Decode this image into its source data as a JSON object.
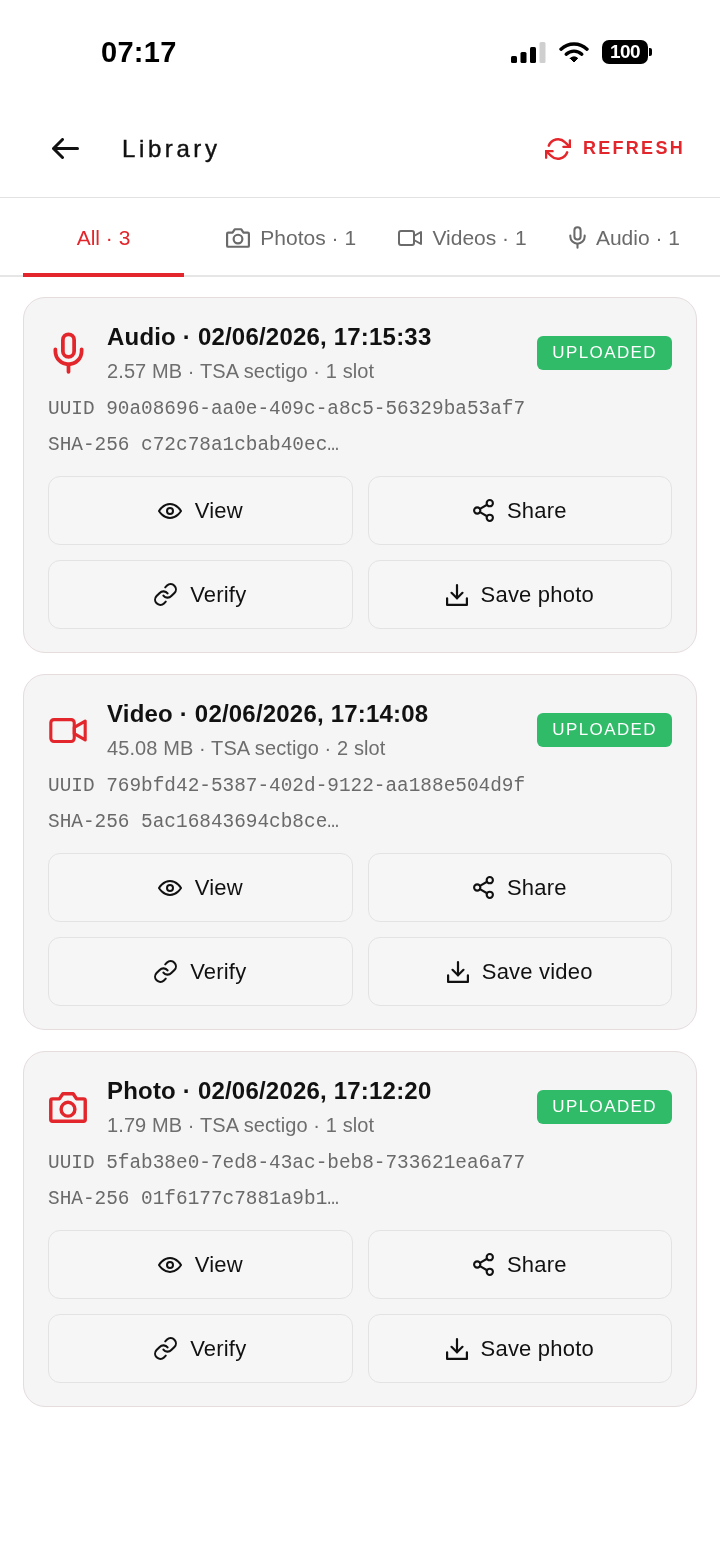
{
  "status_bar": {
    "time": "07:17",
    "battery": "100"
  },
  "header": {
    "title": "Library",
    "action": "REFRESH"
  },
  "tabs": [
    {
      "kind": "all",
      "label": "All · 3",
      "selected": true
    },
    {
      "kind": "photo",
      "label": "Photos · 1",
      "selected": false
    },
    {
      "kind": "video",
      "label": "Videos · 1",
      "selected": false
    },
    {
      "kind": "audio",
      "label": "Audio · 1",
      "selected": false
    }
  ],
  "items": [
    {
      "kind": "audio",
      "title": "Audio · 02/06/2026, 17:15:33",
      "details": "2.57 MB · TSA sectigo · 1 slot",
      "status": {
        "kind": "uploaded",
        "label": "UPLOADED"
      },
      "uuid": "UUID 90a08696-aa0e-409c-a8c5-56329ba53af7",
      "hash": "SHA-256 c72c78a1cbab40ec…",
      "actions": [
        {
          "kind": "view",
          "label": "View"
        },
        {
          "kind": "share",
          "label": "Share"
        },
        {
          "kind": "verify",
          "label": "Verify"
        },
        {
          "kind": "save",
          "label": "Save photo"
        }
      ]
    },
    {
      "kind": "video",
      "title": "Video · 02/06/2026, 17:14:08",
      "details": "45.08 MB · TSA sectigo · 2 slot",
      "status": {
        "kind": "uploaded",
        "label": "UPLOADED"
      },
      "uuid": "UUID 769bfd42-5387-402d-9122-aa188e504d9f",
      "hash": "SHA-256 5ac16843694cb8ce…",
      "actions": [
        {
          "kind": "view",
          "label": "View"
        },
        {
          "kind": "share",
          "label": "Share"
        },
        {
          "kind": "verify",
          "label": "Verify"
        },
        {
          "kind": "save",
          "label": "Save video"
        }
      ]
    },
    {
      "kind": "photo",
      "title": "Photo · 02/06/2026, 17:12:20",
      "details": "1.79 MB · TSA sectigo · 1 slot",
      "status": {
        "kind": "uploaded",
        "label": "UPLOADED"
      },
      "uuid": "UUID 5fab38e0-7ed8-43ac-beb8-733621ea6a77",
      "hash": "SHA-256 01f6177c7881a9b1…",
      "actions": [
        {
          "kind": "view",
          "label": "View"
        },
        {
          "kind": "share",
          "label": "Share"
        },
        {
          "kind": "verify",
          "label": "Verify"
        },
        {
          "kind": "save",
          "label": "Save photo"
        }
      ]
    }
  ]
}
